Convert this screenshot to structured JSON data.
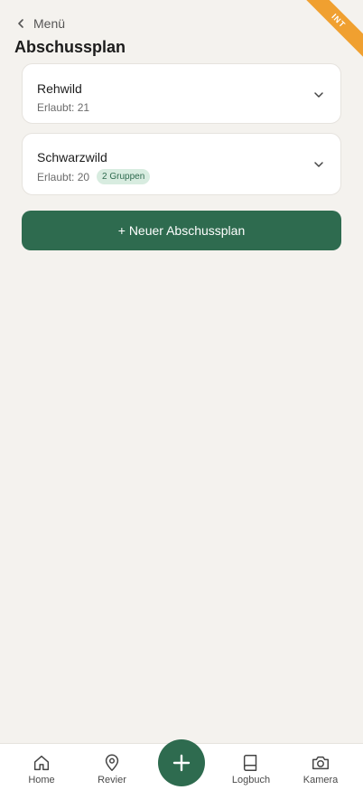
{
  "ribbon": {
    "label": "INT"
  },
  "header": {
    "back_label": "Menü",
    "title": "Abschussplan"
  },
  "plans": [
    {
      "name": "Rehwild",
      "allowed": "Erlaubt: 21"
    },
    {
      "name": "Schwarzwild",
      "allowed": "Erlaubt: 20",
      "badge": "2 Gruppen"
    }
  ],
  "new_plan_label": "+ Neuer Abschussplan",
  "nav": {
    "home": "Home",
    "revier": "Revier",
    "logbuch": "Logbuch",
    "kamera": "Kamera"
  },
  "colors": {
    "accent": "#2e6b4f",
    "background": "#f4f2ee",
    "ribbon": "#f0a030",
    "badge_bg": "#d8ece0"
  },
  "icons": [
    "chevron-left-icon",
    "chevron-down-icon",
    "home-icon",
    "map-pin-icon",
    "plus-icon",
    "book-icon",
    "camera-icon"
  ]
}
